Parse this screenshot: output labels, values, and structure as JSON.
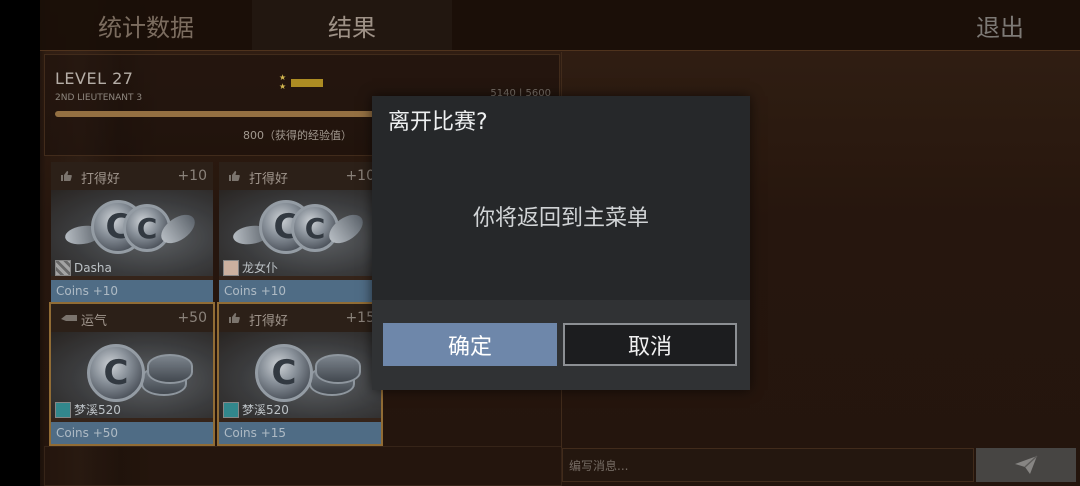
{
  "tabs": {
    "stats": "统计数据",
    "results": "结果",
    "exit": "退出"
  },
  "level": {
    "title": "LEVEL 27",
    "rank": "2ND LIEUTENANT 3",
    "xp": "5140 | 5600",
    "xp_progress": 0.918,
    "gain": "800（获得的经验值）"
  },
  "cards": [
    {
      "title": "打得好",
      "bonus": "+10",
      "player": "Dasha",
      "reward": "Coins +10"
    },
    {
      "title": "打得好",
      "bonus": "+10",
      "player": "龙女仆",
      "reward": "Coins +10"
    },
    {
      "title": "运气",
      "bonus": "+50",
      "player": "梦溪520",
      "reward": "Coins +50"
    },
    {
      "title": "打得好",
      "bonus": "+15",
      "player": "梦溪520",
      "reward": "Coins +15"
    }
  ],
  "chat": {
    "placeholder": "编写消息..."
  },
  "dialog": {
    "title": "离开比赛?",
    "message": "你将返回到主菜单",
    "confirm": "确定",
    "cancel": "取消"
  },
  "colors": {
    "confirm": "#6e87aa",
    "reward_bar": "#5b7c98",
    "accent_gold": "#a57b3d"
  }
}
